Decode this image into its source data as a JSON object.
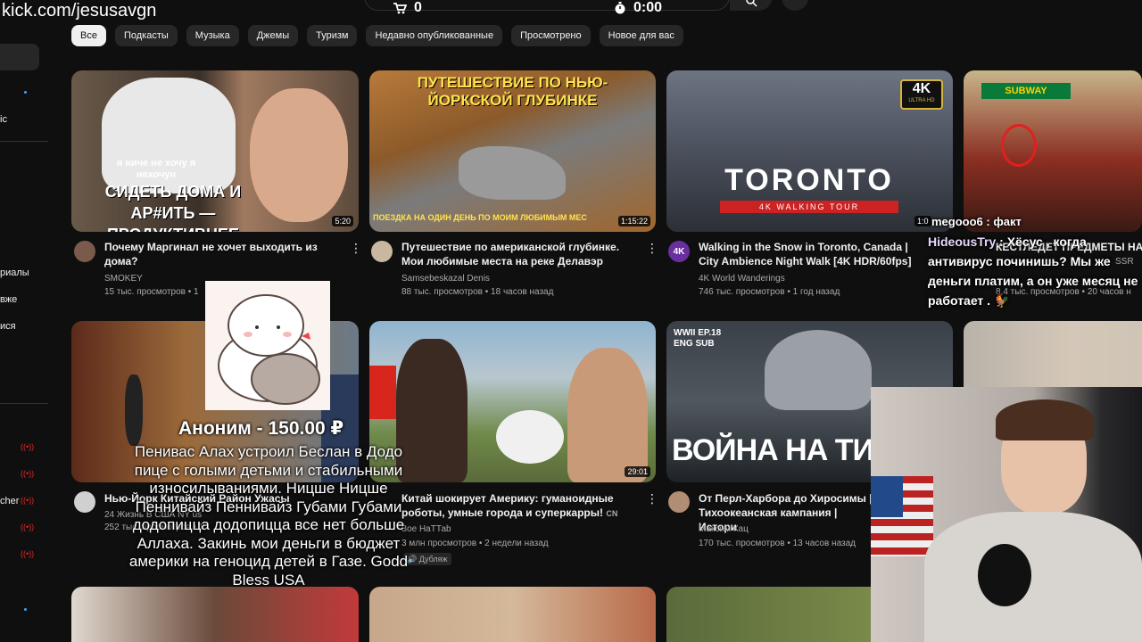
{
  "stream": {
    "url": "kick.com/jesusavgn",
    "cart_count": "0",
    "timer": "0:00"
  },
  "sidebar": {
    "items": [
      "ic",
      "риалы",
      "вже",
      "ися",
      "cher"
    ]
  },
  "chips": [
    "Все",
    "Подкасты",
    "Музыка",
    "Джемы",
    "Туризм",
    "Недавно опубликованные",
    "Просмотрено",
    "Новое для вас"
  ],
  "videos": [
    {
      "thumb_text1": "я ниче не хочу я нехочун",
      "thumb_text2": "СИДЕТЬ ДОМА И АР#ИТЬ — ПРОДУКТИВНЕЕ",
      "duration": "5:20",
      "title": "Почему Маргинал не хочет выходить из дома?",
      "channel": "SMOKEY",
      "meta": "15 тыс. просмотров • 1"
    },
    {
      "thumb_text1": "ПУТЕШЕСТВИЕ ПО НЬЮ-ЙОРКСКОЙ ГЛУБИНКЕ",
      "thumb_text2": "ПОЕЗДКА НА ОДИН ДЕНЬ ПО МОИМ ЛЮБИМЫМ МЕС",
      "duration": "1:15:22",
      "title": "Путешествие по американской глубинке. Мои любимые места на реке Делавэр",
      "channel": "Samsebeskazal Denis",
      "meta": "88 тыс. просмотров • 18 часов назад"
    },
    {
      "badge": "4K",
      "badge_sub": "ULTRA HD",
      "thumb_text1": "TORONTO",
      "thumb_text2": "4K WALKING TOUR",
      "duration": "1:0",
      "avatar_text": "4K",
      "title": "Walking in the Snow in Toronto, Canada | City Ambience Night Walk [4K HDR/60fps]",
      "channel": "4K World Wanderings",
      "meta": "746 тыс. просмотров • 1 год назад"
    },
    {
      "thumb_text1": "SUBWAY",
      "title": "КЕСТЛЕДЕТ ПРЕДМЕТЫ НА",
      "channel": "SSR",
      "meta": "8,4 тыс. просмотров • 20 часов н"
    },
    {
      "duration": "",
      "title": "Нью-Йорк Китайский Район Ужасы",
      "channel": "24 Жизнь В США NY us",
      "meta": "252 тыс. просмотров • 1"
    },
    {
      "duration": "29:01",
      "title": "Китай шокирует Америку: гуманоидные роботы, умные города и суперкарры!",
      "title_suffix": "CN",
      "channel": "Зое НаТТаb",
      "meta": "3 млн просмотров • 2 недели назад",
      "tag": "Дубляж"
    },
    {
      "thumb_text1": "WWII EP.18",
      "thumb_text2": "ENG SUB",
      "thumb_text3": "ВОЙНА НА ТИХОМ О",
      "title": "От Перл-Харбора до Хиросимы | Тихоокеанская кампания | Истори",
      "channel": "Максим Кац",
      "meta": "170 тыс. просмотров • 13 часов назад"
    }
  ],
  "donation": {
    "name": "Аноним - 150.00 ₽",
    "message": "Пенивас Алах устроил Беслан в Додо пице с голыми детьми и стабильными износилываниями. Ницше Ницше Пеннивайз Пеннивайз Губами Губами додопицца додопицца все нет больше Аллаха. Закинь мои деньги в бюджет америки на геноцид детей в Газе. Godd Bless USA"
  },
  "chat": [
    {
      "user": "",
      "text": "megooo6 : факт"
    },
    {
      "user": "HideousTry",
      "text": ": Хёсус , когда антивирус починишь? Мы же деньги платим, а он уже месяц не работает . 🐓"
    }
  ],
  "colors": {
    "background": "#0f0f0f",
    "chip": "#272727",
    "chip_active": "#f1f1f1",
    "meta_text": "#aaaaaa",
    "live": "#ee2222"
  }
}
